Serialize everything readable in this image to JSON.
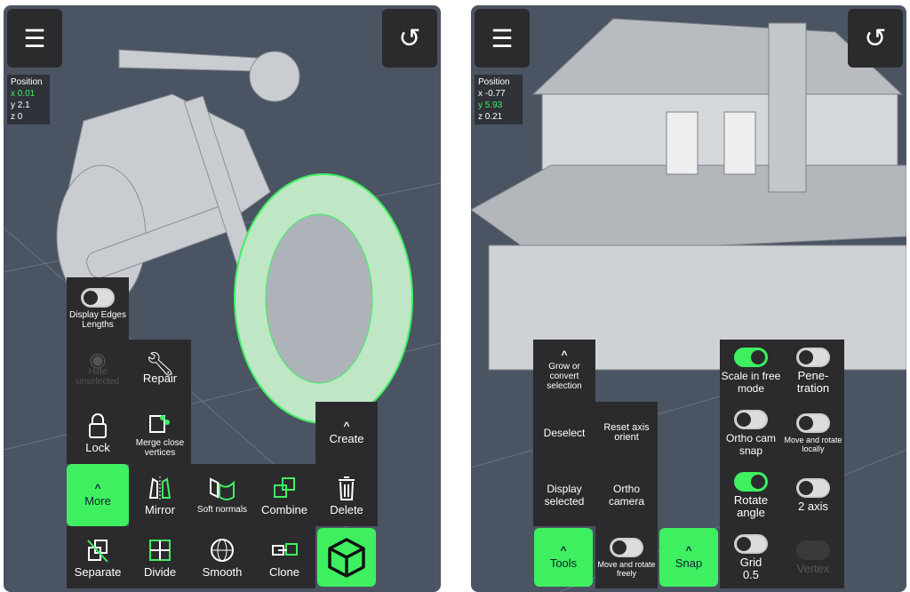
{
  "left": {
    "position": {
      "title": "Position",
      "x": "0.01",
      "y": "2.1",
      "z": "0",
      "active_axis": "x"
    },
    "menu": {
      "display_edges": "Display Edges Lengths",
      "hide": "Hide unselected",
      "repair": "Repair",
      "lock": "Lock",
      "merge": "Merge close vertices",
      "create": "Create",
      "more": "More",
      "mirror": "Mirror",
      "soft": "Soft normals",
      "combine": "Combine",
      "delete": "Delete",
      "separate": "Separate",
      "divide": "Divide",
      "smooth": "Smooth",
      "clone": "Clone"
    }
  },
  "right": {
    "position": {
      "title": "Position",
      "x": "-0.77",
      "y": "5.93",
      "z": "0.21",
      "active_axis": "y"
    },
    "menu": {
      "grow": "Grow or convert selection",
      "deselect": "Deselect",
      "reset": "Reset axis orient",
      "display_selected": "Display selected",
      "ortho_camera": "Ortho camera",
      "tools": "Tools",
      "move_freely": "Move and rotate freely",
      "snap": "Snap",
      "scale": "Scale in free mode",
      "pene": "Pene-tration",
      "ortho_snap": "Ortho cam snap",
      "move_locally": "Move and rotate locally",
      "rotate": "Rotate angle",
      "two_axis": "2 axis",
      "grid": "Grid 0.5",
      "vertex": "Vertex"
    },
    "toggles": {
      "scale": true,
      "pene": false,
      "ortho_snap": false,
      "move_locally": false,
      "rotate": true,
      "two_axis": false,
      "grid": false,
      "move_freely": false
    }
  },
  "colors": {
    "accent": "#3ef060",
    "panel": "#2b2b2d",
    "viewport": "#4b5462"
  }
}
